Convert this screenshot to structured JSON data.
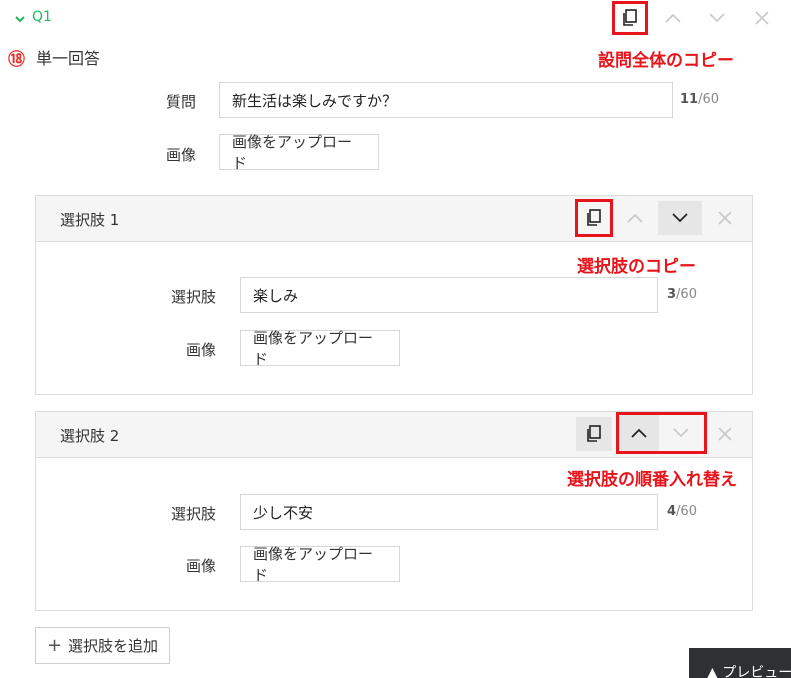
{
  "question": {
    "label": "Q1",
    "type_number": "⑱",
    "type_label": "単一回答",
    "question_label": "質問",
    "question_value": "新生活は楽しみですか？",
    "question_count": "11",
    "question_max": "/60",
    "image_label": "画像",
    "upload_label": "画像をアップロード"
  },
  "choices": [
    {
      "title": "選択肢 1",
      "choice_label": "選択肢",
      "value": "楽しみ",
      "count": "3",
      "max": "/60",
      "image_label": "画像",
      "upload_label": "画像をアップロード"
    },
    {
      "title": "選択肢 2",
      "choice_label": "選択肢",
      "value": "少し不安",
      "count": "4",
      "max": "/60",
      "image_label": "画像",
      "upload_label": "画像をアップロード"
    }
  ],
  "annotations": {
    "copy_question": "設問全体のコピー",
    "copy_choice": "選択肢のコピー",
    "reorder_choice": "選択肢の順番入れ替え"
  },
  "add_choice_label": "選択肢を追加",
  "add_choice_icon": "+",
  "preview_label": "▲ プレビュー",
  "colors": {
    "accent_green": "#1dbb5a",
    "annotation_red": "#e8141b",
    "icon_active": "#222222",
    "icon_disabled": "#c8c8c8"
  }
}
